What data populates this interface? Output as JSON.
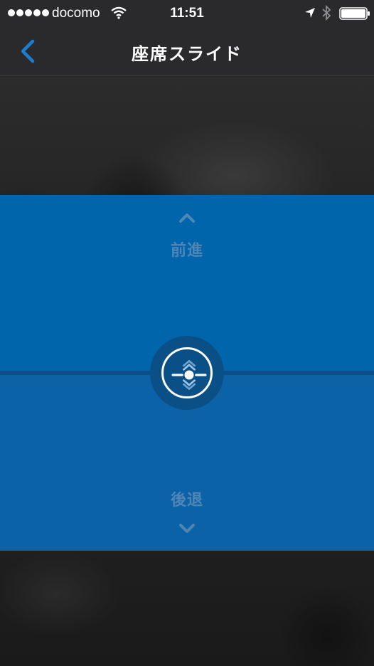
{
  "status_bar": {
    "carrier": "docomo",
    "time": "11:51",
    "icons": [
      "signal-dots-icon",
      "wifi-icon",
      "location-arrow-icon",
      "bluetooth-icon",
      "battery-icon"
    ]
  },
  "nav": {
    "title": "座席スライド",
    "back_icon": "chevron-left-icon"
  },
  "control": {
    "forward_label": "前進",
    "backward_label": "後退",
    "handle_icon": "slider-handle-icon"
  },
  "colors": {
    "accent": "#1a7fd1",
    "panel_forward": "#0065ab",
    "panel_backward": "#0c62a6",
    "label": "#4f86b6"
  }
}
